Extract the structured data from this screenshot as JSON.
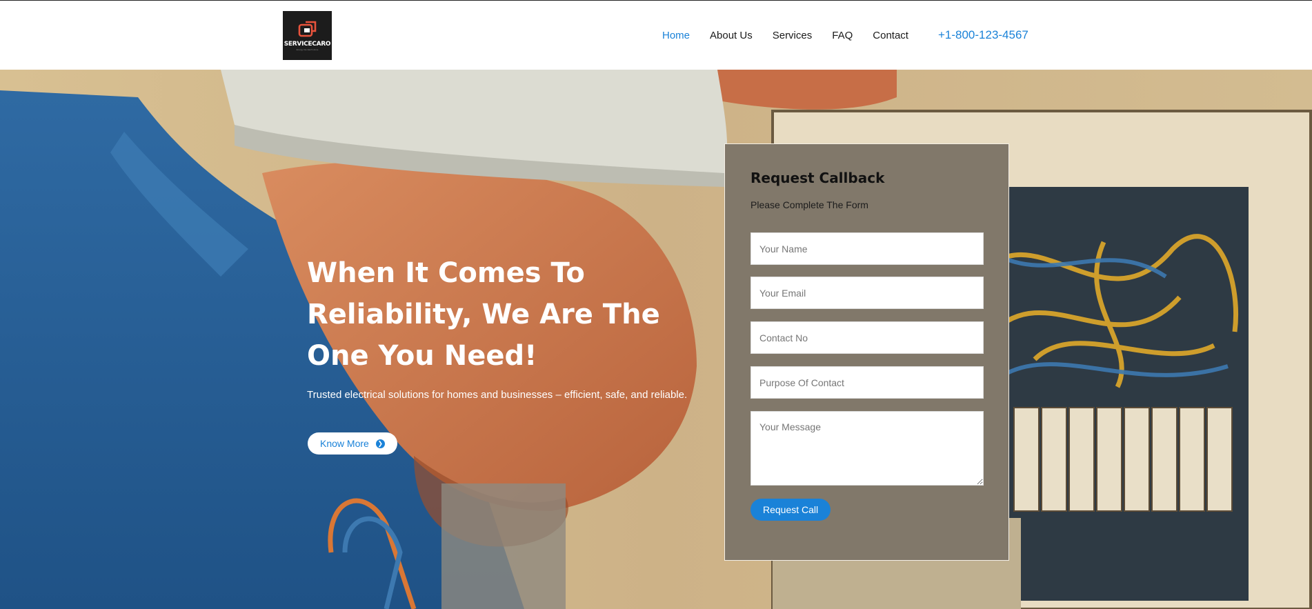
{
  "brand": {
    "logo_text": "SERVICECARO",
    "tagline": "Energy Into Each Home"
  },
  "nav": {
    "items": [
      {
        "label": "Home",
        "active": true
      },
      {
        "label": "About Us",
        "active": false
      },
      {
        "label": "Services",
        "active": false
      },
      {
        "label": "FAQ",
        "active": false
      },
      {
        "label": "Contact",
        "active": false
      }
    ],
    "phone": "+1-800-123-4567"
  },
  "hero": {
    "title": "When It Comes To Reliability, We Are The One You Need!",
    "subtitle": "Trusted electrical solutions for homes and businesses – efficient, safe, and reliable.",
    "cta_label": "Know More",
    "cta_icon": "chevron-right-circle-icon"
  },
  "form": {
    "title": "Request Callback",
    "subtitle": "Please Complete The Form",
    "fields": {
      "name_placeholder": "Your Name",
      "email_placeholder": "Your Email",
      "contact_placeholder": "Contact No",
      "purpose_placeholder": "Purpose Of Contact",
      "message_placeholder": "Your Message"
    },
    "submit_label": "Request Call"
  },
  "colors": {
    "accent": "#1a82d8",
    "form_bg": "#81786a",
    "header_bg": "#ffffff"
  }
}
